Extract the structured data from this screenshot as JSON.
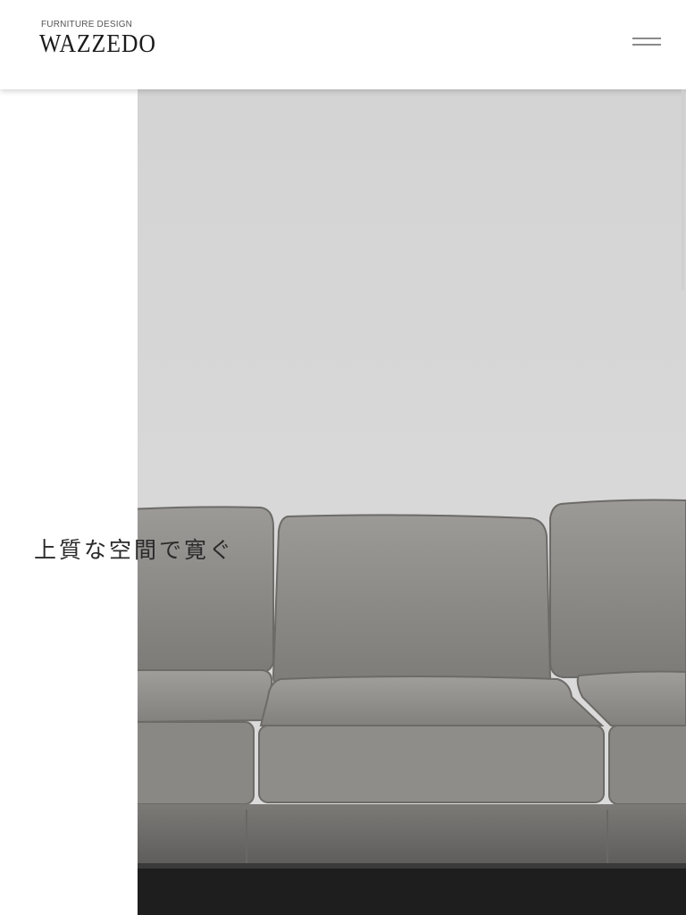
{
  "header": {
    "tagline": "FURNITURE DESIGN",
    "logo": "WAZZEDO",
    "menu_icon": "hamburger-icon"
  },
  "hero": {
    "catchcopy": "上質な空間で寛ぐ",
    "image_subject": "grey leather three-seat sofa against a light grey wall"
  },
  "colors": {
    "wall": "#d7d7d7",
    "sofa": "#8f8d8a",
    "floor": "#1e1e1e",
    "text": "#2a2a2a"
  }
}
